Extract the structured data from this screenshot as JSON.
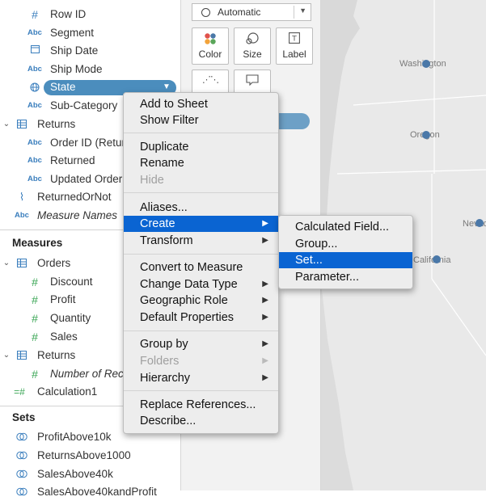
{
  "data_pane": {
    "fields_top": [
      {
        "icon": "#",
        "label": "Row ID"
      },
      {
        "icon": "Abc",
        "label": "Segment"
      },
      {
        "icon": "calendar",
        "label": "Ship Date"
      },
      {
        "icon": "Abc",
        "label": "Ship Mode"
      },
      {
        "icon": "globe",
        "label": "State"
      },
      {
        "icon": "Abc",
        "label": "Sub-Category"
      }
    ],
    "returns_table": "Returns",
    "returns_fields": [
      {
        "icon": "Abc",
        "label": "Order ID (Returns)"
      },
      {
        "icon": "Abc",
        "label": "Returned"
      },
      {
        "icon": "Abc",
        "label": "Updated Order"
      }
    ],
    "returned_or_not": "ReturnedOrNot",
    "measure_names": "Measure Names",
    "measures_header": "Measures",
    "orders_table": "Orders",
    "orders_measures": [
      "Discount",
      "Profit",
      "Quantity",
      "Sales"
    ],
    "returns_table2": "Returns",
    "returns_measure": "Number of Records",
    "calculation": "Calculation1",
    "sets_header": "Sets",
    "sets": [
      "ProfitAbove10k",
      "ReturnsAbove1000",
      "SalesAbove40k",
      "SalesAbove40kandProfit"
    ]
  },
  "marks": {
    "type_label": "Automatic",
    "buttons": [
      "Color",
      "Size",
      "Label"
    ]
  },
  "map": {
    "labels": [
      "Washington",
      "Oregon",
      "California",
      "Nevada"
    ]
  },
  "context_menu": {
    "groups": [
      [
        {
          "label": "Add to Sheet"
        },
        {
          "label": "Show Filter"
        }
      ],
      [
        {
          "label": "Duplicate"
        },
        {
          "label": "Rename"
        },
        {
          "label": "Hide",
          "disabled": true
        }
      ],
      [
        {
          "label": "Aliases..."
        },
        {
          "label": "Create",
          "submenu": true,
          "highlighted": true
        },
        {
          "label": "Transform",
          "submenu": true
        }
      ],
      [
        {
          "label": "Convert to Measure"
        },
        {
          "label": "Change Data Type",
          "submenu": true
        },
        {
          "label": "Geographic Role",
          "submenu": true
        },
        {
          "label": "Default Properties",
          "submenu": true
        }
      ],
      [
        {
          "label": "Group by",
          "submenu": true
        },
        {
          "label": "Folders",
          "submenu": true,
          "disabled": true
        },
        {
          "label": "Hierarchy",
          "submenu": true
        }
      ],
      [
        {
          "label": "Replace References..."
        },
        {
          "label": "Describe..."
        }
      ]
    ]
  },
  "create_submenu": {
    "items": [
      {
        "label": "Calculated Field..."
      },
      {
        "label": "Group..."
      },
      {
        "label": "Set...",
        "highlighted": true
      },
      {
        "label": "Parameter..."
      }
    ]
  },
  "colors": {
    "highlight": "#0a64d2",
    "pill": "#4b8dbd",
    "field_icon": "#3a7ebd",
    "map_dot": "#4a78a8",
    "measure_icon": "#3aa655"
  }
}
